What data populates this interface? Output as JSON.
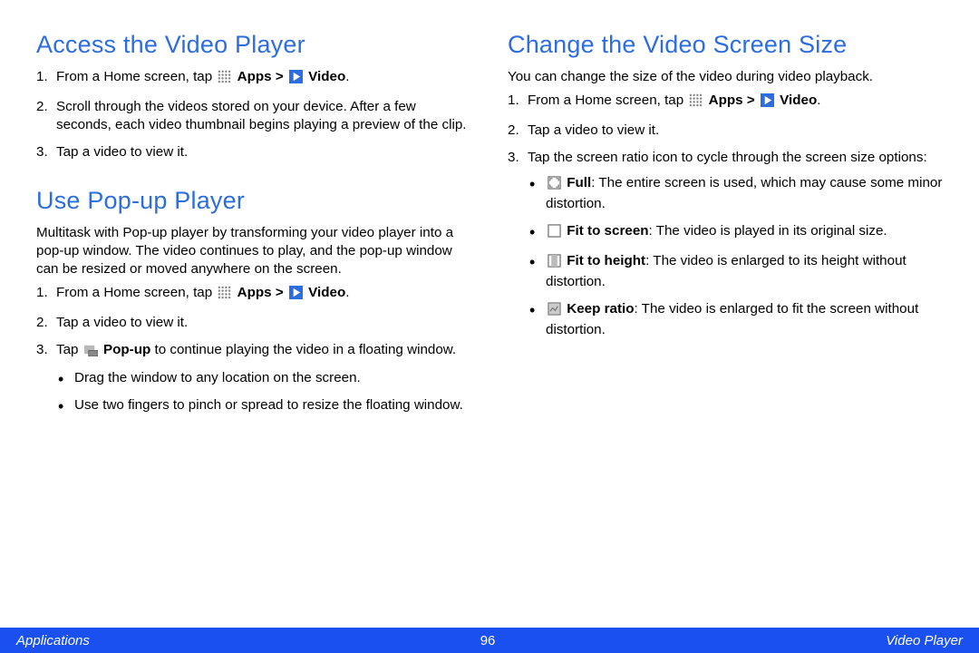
{
  "left": {
    "section1": {
      "heading": "Access the Video Player",
      "steps": [
        {
          "pre": "From a Home screen, tap ",
          "apps": "Apps",
          "gt": " > ",
          "video": "Video",
          "post": "."
        },
        {
          "text": "Scroll through the videos stored on your device. After a few seconds, each video thumbnail begins playing a preview of the clip."
        },
        {
          "text": "Tap a video to view it."
        }
      ]
    },
    "section2": {
      "heading": "Use Pop-up Player",
      "intro": "Multitask with Pop-up player by transforming your video player into a pop-up window. The video continues to play, and the pop-up window can be resized or moved anywhere on the screen.",
      "steps": [
        {
          "pre": "From a Home screen, tap ",
          "apps": "Apps",
          "gt": " > ",
          "video": "Video",
          "post": "."
        },
        {
          "text": "Tap a video to view it."
        },
        {
          "pre": "Tap ",
          "popup": "Pop-up",
          "post": " to continue playing the video in a floating window.",
          "sub": [
            "Drag the window to any location on the screen.",
            "Use two fingers to pinch or spread to resize the floating window."
          ]
        }
      ]
    }
  },
  "right": {
    "heading": "Change the Video Screen Size",
    "intro": "You can change the size of the video during video playback.",
    "steps": [
      {
        "pre": "From a Home screen, tap ",
        "apps": "Apps",
        "gt": " > ",
        "video": "Video",
        "post": "."
      },
      {
        "text": "Tap a video to view it."
      },
      {
        "text": "Tap the screen ratio icon to cycle through the screen size options:",
        "sub": [
          {
            "label": "Full",
            "desc": ": The entire screen is used, which may cause some minor distortion."
          },
          {
            "label": "Fit to screen",
            "desc": ": The video is played in its original size."
          },
          {
            "label": "Fit to height",
            "desc": ": The video is enlarged to its height without distortion."
          },
          {
            "label": "Keep ratio",
            "desc": ": The video is enlarged to fit the screen without distortion."
          }
        ]
      }
    ]
  },
  "footer": {
    "left": "Applications",
    "page": "96",
    "right": "Video Player"
  }
}
